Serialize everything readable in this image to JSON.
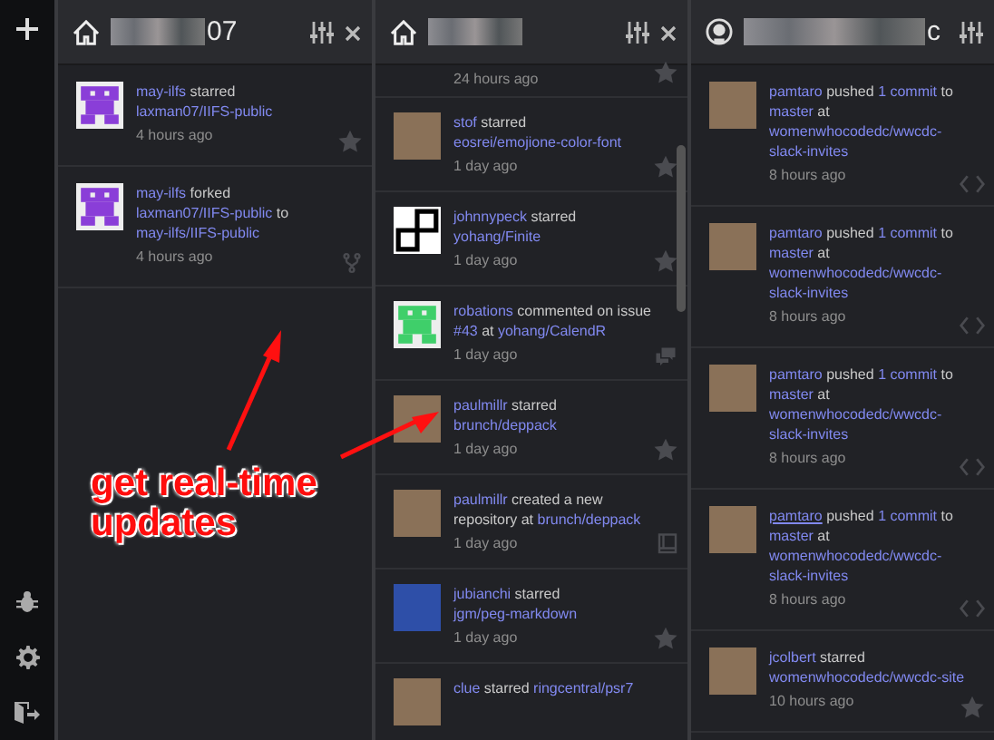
{
  "columns": [
    {
      "title": "07",
      "events": [
        {
          "kind": "starred",
          "segments": [
            {
              "text": "may-ilfs",
              "kind": "link"
            },
            {
              "text": " starred ",
              "kind": "text"
            },
            {
              "text": "laxman07/IIFS-public",
              "kind": "link"
            }
          ],
          "time": "4 hours ago"
        },
        {
          "kind": "forked",
          "segments": [
            {
              "text": "may-ilfs",
              "kind": "link"
            },
            {
              "text": " forked ",
              "kind": "text"
            },
            {
              "text": "laxman07/IIFS-public",
              "kind": "link"
            },
            {
              "text": " to ",
              "kind": "text"
            },
            {
              "text": "may-ilfs/IIFS-public",
              "kind": "link"
            }
          ],
          "time": "4 hours ago"
        }
      ]
    },
    {
      "events": [
        {
          "kind": "starred",
          "time": "24 hours ago"
        },
        {
          "kind": "starred",
          "segments": [
            {
              "text": "stof",
              "kind": "link"
            },
            {
              "text": " starred ",
              "kind": "text"
            },
            {
              "text": "eosrei/emojione-color-font",
              "kind": "link"
            }
          ],
          "time": "1 day ago"
        },
        {
          "kind": "starred",
          "segments": [
            {
              "text": "johnnypeck",
              "kind": "link"
            },
            {
              "text": " starred ",
              "kind": "text"
            },
            {
              "text": "yohang/Finite",
              "kind": "link"
            }
          ],
          "time": "1 day ago"
        },
        {
          "kind": "commented",
          "segments": [
            {
              "text": "robations",
              "kind": "link"
            },
            {
              "text": " commented on issue ",
              "kind": "text"
            },
            {
              "text": "#43",
              "kind": "link"
            },
            {
              "text": " at ",
              "kind": "text"
            },
            {
              "text": "yohang/CalendR",
              "kind": "link"
            }
          ],
          "time": "1 day ago"
        },
        {
          "kind": "starred",
          "segments": [
            {
              "text": "paulmillr",
              "kind": "link"
            },
            {
              "text": " starred ",
              "kind": "text"
            },
            {
              "text": "brunch/deppack",
              "kind": "link"
            }
          ],
          "time": "1 day ago"
        },
        {
          "kind": "created",
          "segments": [
            {
              "text": "paulmillr",
              "kind": "link"
            },
            {
              "text": " created a new repository at ",
              "kind": "text"
            },
            {
              "text": "brunch/deppack",
              "kind": "link"
            }
          ],
          "time": "1 day ago"
        },
        {
          "kind": "starred",
          "segments": [
            {
              "text": "jubianchi",
              "kind": "link"
            },
            {
              "text": " starred ",
              "kind": "text"
            },
            {
              "text": "jgm/peg-markdown",
              "kind": "link"
            }
          ],
          "time": "1 day ago"
        },
        {
          "segments": [
            {
              "text": "clue",
              "kind": "link"
            },
            {
              "text": " starred ",
              "kind": "text"
            },
            {
              "text": "ringcentral/psr7",
              "kind": "link"
            }
          ]
        }
      ]
    },
    {
      "title": "c",
      "events": [
        {
          "kind": "pushed",
          "segments": [
            {
              "text": "pamtaro",
              "kind": "link"
            },
            {
              "text": " pushed ",
              "kind": "text"
            },
            {
              "text": "1 commit",
              "kind": "link"
            },
            {
              "text": " to ",
              "kind": "text"
            },
            {
              "text": "master",
              "kind": "link"
            },
            {
              "text": " at ",
              "kind": "text"
            },
            {
              "text": "womenwhocodedc/wwcdc-slack-invites",
              "kind": "link"
            }
          ],
          "time": "8 hours ago"
        },
        {
          "kind": "pushed",
          "segments": [
            {
              "text": "pamtaro",
              "kind": "link"
            },
            {
              "text": " pushed ",
              "kind": "text"
            },
            {
              "text": "1 commit",
              "kind": "link"
            },
            {
              "text": " to ",
              "kind": "text"
            },
            {
              "text": "master",
              "kind": "link"
            },
            {
              "text": " at ",
              "kind": "text"
            },
            {
              "text": "womenwhocodedc/wwcdc-slack-invites",
              "kind": "link"
            }
          ],
          "time": "8 hours ago"
        },
        {
          "kind": "pushed",
          "segments": [
            {
              "text": "pamtaro",
              "kind": "link"
            },
            {
              "text": " pushed ",
              "kind": "text"
            },
            {
              "text": "1 commit",
              "kind": "link"
            },
            {
              "text": " to ",
              "kind": "text"
            },
            {
              "text": "master",
              "kind": "link"
            },
            {
              "text": " at ",
              "kind": "text"
            },
            {
              "text": "womenwhocodedc/wwcdc-slack-invites",
              "kind": "link"
            }
          ],
          "time": "8 hours ago"
        },
        {
          "kind": "pushed",
          "segments": [
            {
              "text": "pamtaro",
              "kind": "link",
              "hovered": true
            },
            {
              "text": " pushed ",
              "kind": "text"
            },
            {
              "text": "1 commit",
              "kind": "link"
            },
            {
              "text": " to ",
              "kind": "text"
            },
            {
              "text": "master",
              "kind": "link"
            },
            {
              "text": " at ",
              "kind": "text"
            },
            {
              "text": "womenwhocodedc/wwcdc-slack-invites",
              "kind": "link"
            }
          ],
          "time": "8 hours ago"
        },
        {
          "kind": "starred",
          "segments": [
            {
              "text": "jcolbert",
              "kind": "link"
            },
            {
              "text": " starred ",
              "kind": "text"
            },
            {
              "text": "womenwhocodedc/wwcdc-site",
              "kind": "link"
            }
          ],
          "time": "10 hours ago"
        }
      ]
    }
  ],
  "annotation": {
    "text": "get real-time updates"
  }
}
